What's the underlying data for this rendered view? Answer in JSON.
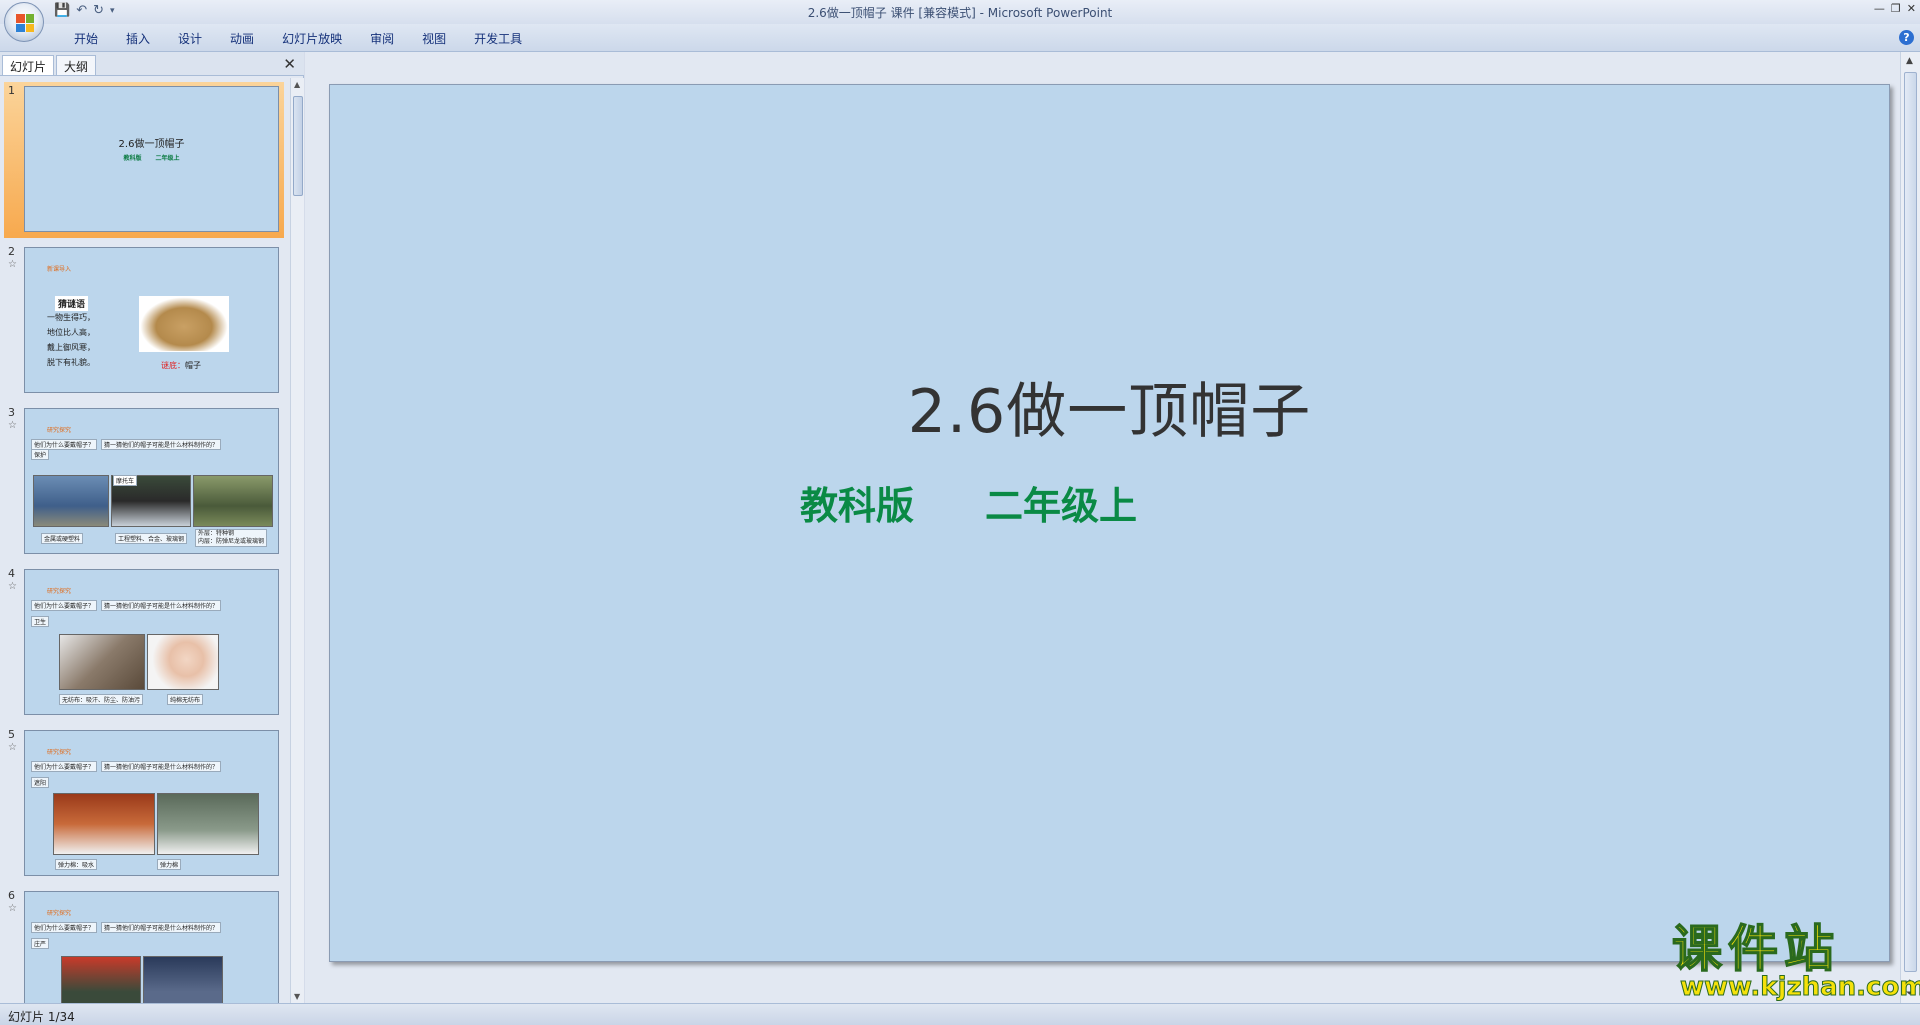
{
  "window": {
    "title": "2.6做一顶帽子 课件 [兼容模式] - Microsoft PowerPoint"
  },
  "ribbon": {
    "tabs": [
      "开始",
      "插入",
      "设计",
      "动画",
      "幻灯片放映",
      "审阅",
      "视图",
      "开发工具"
    ]
  },
  "panel": {
    "tabs": [
      "幻灯片",
      "大纲"
    ],
    "close": "✕"
  },
  "thumbs": [
    {
      "num": "1",
      "title": "2.6做一顶帽子",
      "sub": "教科版 二年级上"
    },
    {
      "num": "2",
      "heading": "新课导入",
      "box": "猜谜语",
      "lines": [
        "一物生得巧，",
        "地位比人高，",
        "戴上御风寒，",
        "脱下有礼貌。"
      ],
      "answer_label": "谜底：",
      "answer": "帽子"
    },
    {
      "num": "3",
      "heading": "研究探究",
      "q1": "他们为什么要戴帽子？",
      "q2": "猜一猜他们的帽子可能是什么材料制作的？",
      "tag": "保护",
      "caps": [
        "金属或硬塑料",
        "工程塑料、合金、玻璃钢",
        "外层：特种钢\n内层：防弹尼龙或玻璃钢"
      ],
      "pic_label": "摩托车"
    },
    {
      "num": "4",
      "heading": "研究探究",
      "q1": "他们为什么要戴帽子？",
      "q2": "猜一猜他们的帽子可能是什么材料制作的？",
      "tag": "卫生",
      "caps": [
        "无纺布：吸汗、防尘、防油污",
        "纯棉无纺布"
      ]
    },
    {
      "num": "5",
      "heading": "研究探究",
      "q1": "他们为什么要戴帽子？",
      "q2": "猜一猜他们的帽子可能是什么材料制作的？",
      "tag": "遮阳",
      "caps": [
        "弹力棉：吸水",
        "弹力棉"
      ]
    },
    {
      "num": "6",
      "heading": "研究探究",
      "q1": "他们为什么要戴帽子？",
      "q2": "猜一猜他们的帽子可能是什么材料制作的？",
      "tag": "庄严"
    }
  ],
  "slide": {
    "title": "2.6做一顶帽子",
    "sub_left": "教科版",
    "sub_right": "二年级上"
  },
  "status": {
    "text": "幻灯片 1/34"
  },
  "watermark": {
    "cn": "课件站",
    "url": "www.kjzhan.com"
  }
}
